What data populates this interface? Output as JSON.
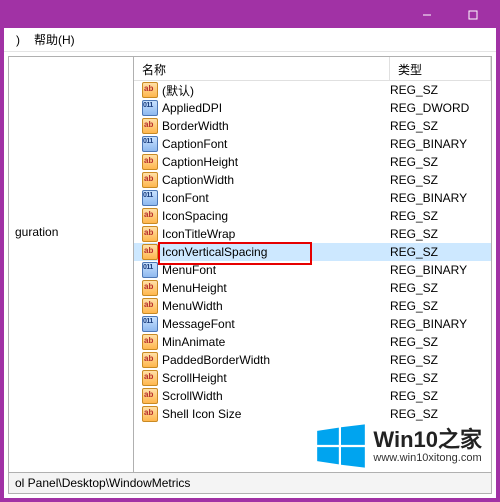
{
  "menubar": {
    "item1": ") ",
    "item2": "帮助(H)"
  },
  "tree": {
    "selected_item": "guration"
  },
  "columns": {
    "name": "名称",
    "type": "类型"
  },
  "rows": [
    {
      "name": "(默认)",
      "type": "REG_SZ",
      "icon": "sz",
      "selected": false,
      "hl": false
    },
    {
      "name": "AppliedDPI",
      "type": "REG_DWORD",
      "icon": "bin",
      "selected": false,
      "hl": false
    },
    {
      "name": "BorderWidth",
      "type": "REG_SZ",
      "icon": "sz",
      "selected": false,
      "hl": false
    },
    {
      "name": "CaptionFont",
      "type": "REG_BINARY",
      "icon": "bin",
      "selected": false,
      "hl": false
    },
    {
      "name": "CaptionHeight",
      "type": "REG_SZ",
      "icon": "sz",
      "selected": false,
      "hl": false
    },
    {
      "name": "CaptionWidth",
      "type": "REG_SZ",
      "icon": "sz",
      "selected": false,
      "hl": false
    },
    {
      "name": "IconFont",
      "type": "REG_BINARY",
      "icon": "bin",
      "selected": false,
      "hl": false
    },
    {
      "name": "IconSpacing",
      "type": "REG_SZ",
      "icon": "sz",
      "selected": false,
      "hl": false
    },
    {
      "name": "IconTitleWrap",
      "type": "REG_SZ",
      "icon": "sz",
      "selected": false,
      "hl": false
    },
    {
      "name": "IconVerticalSpacing",
      "type": "REG_SZ",
      "icon": "sz",
      "selected": true,
      "hl": true
    },
    {
      "name": "MenuFont",
      "type": "REG_BINARY",
      "icon": "bin",
      "selected": false,
      "hl": false
    },
    {
      "name": "MenuHeight",
      "type": "REG_SZ",
      "icon": "sz",
      "selected": false,
      "hl": false
    },
    {
      "name": "MenuWidth",
      "type": "REG_SZ",
      "icon": "sz",
      "selected": false,
      "hl": false
    },
    {
      "name": "MessageFont",
      "type": "REG_BINARY",
      "icon": "bin",
      "selected": false,
      "hl": false
    },
    {
      "name": "MinAnimate",
      "type": "REG_SZ",
      "icon": "sz",
      "selected": false,
      "hl": false
    },
    {
      "name": "PaddedBorderWidth",
      "type": "REG_SZ",
      "icon": "sz",
      "selected": false,
      "hl": false
    },
    {
      "name": "ScrollHeight",
      "type": "REG_SZ",
      "icon": "sz",
      "selected": false,
      "hl": false
    },
    {
      "name": "ScrollWidth",
      "type": "REG_SZ",
      "icon": "sz",
      "selected": false,
      "hl": false
    },
    {
      "name": "Shell Icon Size",
      "type": "REG_SZ",
      "icon": "sz",
      "selected": false,
      "hl": false
    }
  ],
  "statusbar": {
    "path": "ol Panel\\Desktop\\WindowMetrics"
  },
  "watermark": {
    "title": "Win10之家",
    "url": "www.win10xitong.com"
  },
  "colors": {
    "accent": "#a132a5",
    "selection": "#cde8ff",
    "highlight": "#e60000",
    "logo": "#00a4ef"
  }
}
